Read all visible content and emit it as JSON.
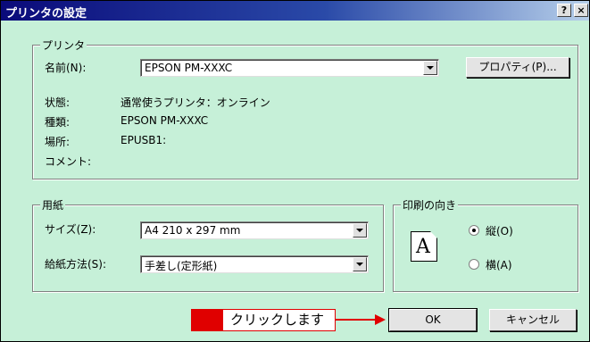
{
  "window": {
    "title": "プリンタの設定",
    "help_button": "?",
    "close_button": "×"
  },
  "printer": {
    "group_label": "プリンタ",
    "name_label": "名前(N):",
    "name_value": "EPSON PM-XXXC",
    "properties_button": "プロパティ(P)...",
    "status_label": "状態:",
    "status_value": "通常使うプリンタ：オンライン",
    "type_label": "種類:",
    "type_value": "EPSON PM-XXXC",
    "location_label": "場所:",
    "location_value": "EPUSB1:",
    "comment_label": "コメント:"
  },
  "paper": {
    "group_label": "用紙",
    "size_label": "サイズ(Z):",
    "size_value": "A4 210 x 297 mm",
    "source_label": "給紙方法(S):",
    "source_value": "手差し(定形紙)"
  },
  "orientation": {
    "group_label": "印刷の向き",
    "icon_letter": "A",
    "portrait_label": "縦(O)",
    "landscape_label": "横(A)",
    "selected": "portrait"
  },
  "buttons": {
    "ok_label": "OK",
    "cancel_label": "キャンセル"
  },
  "callout": {
    "text": "クリックします",
    "accent_color": "#e00000"
  }
}
